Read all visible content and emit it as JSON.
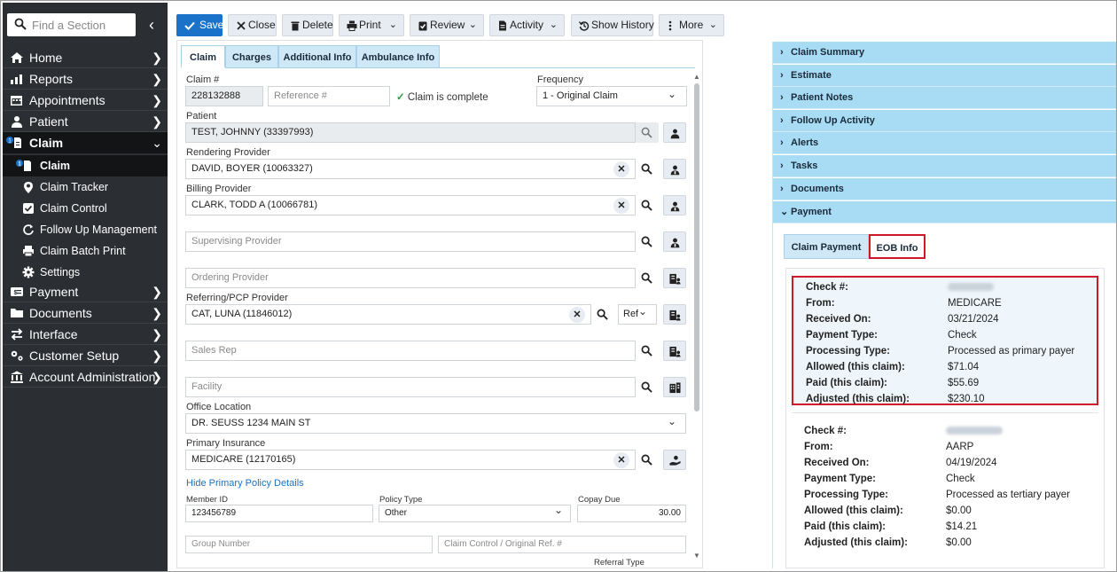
{
  "sidebar": {
    "search_placeholder": "Find a Section",
    "items": [
      {
        "label": "Home",
        "icon": "home-icon"
      },
      {
        "label": "Reports",
        "icon": "reports-icon"
      },
      {
        "label": "Appointments",
        "icon": "calendar-icon"
      },
      {
        "label": "Patient",
        "icon": "person-icon"
      },
      {
        "label": "Claim",
        "icon": "claim-icon",
        "badge": "1"
      },
      {
        "label": "Payment",
        "icon": "payment-icon"
      },
      {
        "label": "Documents",
        "icon": "folder-icon"
      },
      {
        "label": "Interface",
        "icon": "arrows-icon"
      },
      {
        "label": "Customer Setup",
        "icon": "gears-icon"
      },
      {
        "label": "Account Administration",
        "icon": "bank-icon"
      }
    ],
    "claim_sub": [
      {
        "label": "Claim",
        "icon": "claim-icon"
      },
      {
        "label": "Claim Tracker",
        "icon": "map-pin-icon"
      },
      {
        "label": "Claim Control",
        "icon": "checkbox-icon"
      },
      {
        "label": "Follow Up Management",
        "icon": "refresh-icon"
      },
      {
        "label": "Claim Batch Print",
        "icon": "print-icon"
      },
      {
        "label": "Settings",
        "icon": "gear-icon"
      }
    ]
  },
  "toolbar": {
    "save": "Save",
    "close": "Close",
    "delete": "Delete",
    "print": "Print",
    "review": "Review",
    "activity": "Activity",
    "show_history": "Show History",
    "more": "More"
  },
  "claim": {
    "tabs": [
      "Claim",
      "Charges",
      "Additional Info",
      "Ambulance Info"
    ],
    "claim_number_label": "Claim #",
    "claim_number": "228132888",
    "reference_placeholder": "Reference #",
    "complete_text": "Claim is complete",
    "frequency_label": "Frequency",
    "frequency_value": "1 - Original Claim",
    "patient_label": "Patient",
    "patient_value": "TEST, JOHNNY (33397993)",
    "rendering_label": "Rendering Provider",
    "rendering_value": "DAVID, BOYER (10063327)",
    "billing_label": "Billing Provider",
    "billing_value": "CLARK, TODD A (10066781)",
    "supervising_placeholder": "Supervising Provider",
    "ordering_placeholder": "Ordering Provider",
    "referring_label": "Referring/PCP Provider",
    "referring_value": "CAT, LUNA (11846012)",
    "ref_select": "Ref",
    "sales_rep_placeholder": "Sales Rep",
    "facility_placeholder": "Facility",
    "office_label": "Office Location",
    "office_value": "DR. SEUSS 1234 MAIN ST",
    "primary_ins_label": "Primary Insurance",
    "primary_ins_value": "MEDICARE (12170165)",
    "hide_policy_link": "Hide Primary Policy Details",
    "member_id_label": "Member ID",
    "member_id_value": "123456789",
    "policy_type_label": "Policy Type",
    "policy_type_value": "Other",
    "copay_label": "Copay Due",
    "copay_value": "30.00",
    "group_placeholder": "Group Number",
    "claim_control_placeholder": "Claim Control / Original Ref. #",
    "referral_type_label": "Referral Type"
  },
  "right": {
    "sections": [
      "Claim Summary",
      "Estimate",
      "Patient Notes",
      "Follow Up Activity",
      "Alerts",
      "Tasks",
      "Documents",
      "Payment"
    ],
    "payment_tabs": [
      "Claim Payment",
      "EOB Info"
    ],
    "field_labels": [
      "Check #:",
      "From:",
      "Received On:",
      "Payment Type:",
      "Processing Type:",
      "Allowed (this claim):",
      "Paid (this claim):",
      "Adjusted (this claim):"
    ],
    "payments": [
      {
        "from": "MEDICARE",
        "received_on": "03/21/2024",
        "payment_type": "Check",
        "processing_type": "Processed as primary payer",
        "allowed": "$71.04",
        "paid": "$55.69",
        "adjusted": "$230.10"
      },
      {
        "from": "AARP",
        "received_on": "04/19/2024",
        "payment_type": "Check",
        "processing_type": "Processed as tertiary payer",
        "allowed": "$0.00",
        "paid": "$14.21",
        "adjusted": "$0.00"
      }
    ]
  },
  "colors": {
    "sidebar_bg": "#2b2e33",
    "primary": "#1a73c8",
    "accordion": "#a8dcf5",
    "highlight": "#d0182b"
  }
}
